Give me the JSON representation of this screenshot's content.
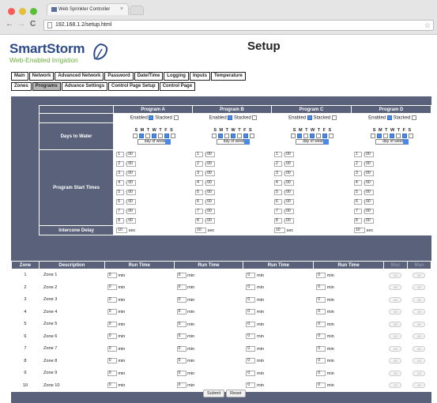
{
  "browser": {
    "tab_title": "Web Sprinkler Controller",
    "tab_close": "×",
    "url": "192.168.1.2/setup.html",
    "back": "←",
    "forward": "→",
    "reload": "C",
    "star": "☆",
    "colors": {
      "close": "#fc5b57",
      "minimize": "#e5bf3c",
      "zoom": "#57c038"
    }
  },
  "brand": {
    "name": "SmartStorm",
    "tagline": "Web-Enabled Irrigation",
    "name_color": "#2d4a8a",
    "tagline_color": "#6aaf3c"
  },
  "page_title": "Setup",
  "nav_row1": [
    {
      "label": "Main",
      "active": false
    },
    {
      "label": "Network",
      "active": false
    },
    {
      "label": "Advanced Network",
      "active": false
    },
    {
      "label": "Password",
      "active": false
    },
    {
      "label": "Date/Time",
      "active": false
    },
    {
      "label": "Logging",
      "active": false
    },
    {
      "label": "Inputs",
      "active": false
    },
    {
      "label": "Temperature",
      "active": false
    }
  ],
  "nav_row2": [
    {
      "label": "Zones",
      "active": false
    },
    {
      "label": "Programs",
      "active": true
    },
    {
      "label": "Advance Settings",
      "active": false
    },
    {
      "label": "Control Page Setup",
      "active": false
    },
    {
      "label": "Control Page",
      "active": false
    }
  ],
  "programs": {
    "enabled_label": "Enabled",
    "stacked_label": "Stacked",
    "days_letters": "S M T W T F S",
    "days_label": "Days to Water",
    "start_times_label": "Program Start Times",
    "interzone_label": "Intercone Delay",
    "sec_unit": "sec",
    "columns": [
      {
        "name": "Program A",
        "enabled": true,
        "stacked": false,
        "day_mode": "day of week",
        "days": [
          false,
          true,
          false,
          true,
          false,
          true,
          false
        ],
        "times": [
          [
            "1",
            "00"
          ],
          [
            "2",
            "00"
          ],
          [
            "3",
            "00"
          ],
          [
            "4",
            "00"
          ],
          [
            "5",
            "00"
          ],
          [
            "6",
            "00"
          ],
          [
            "7",
            "00"
          ],
          [
            "8",
            "00"
          ]
        ],
        "delay": "10"
      },
      {
        "name": "Program B",
        "enabled": true,
        "stacked": false,
        "day_mode": "day of week",
        "days": [
          false,
          true,
          false,
          true,
          false,
          true,
          false
        ],
        "times": [
          [
            "1",
            "00"
          ],
          [
            "2",
            "00"
          ],
          [
            "3",
            "00"
          ],
          [
            "4",
            "00"
          ],
          [
            "5",
            "00"
          ],
          [
            "6",
            "00"
          ],
          [
            "7",
            "00"
          ],
          [
            "8",
            "00"
          ]
        ],
        "delay": "10"
      },
      {
        "name": "Program C",
        "enabled": true,
        "stacked": false,
        "day_mode": "day of week",
        "days": [
          false,
          true,
          false,
          true,
          false,
          true,
          false
        ],
        "times": [
          [
            "1",
            "00"
          ],
          [
            "2",
            "00"
          ],
          [
            "3",
            "00"
          ],
          [
            "4",
            "00"
          ],
          [
            "5",
            "00"
          ],
          [
            "6",
            "00"
          ],
          [
            "7",
            "00"
          ],
          [
            "8",
            "00"
          ]
        ],
        "delay": "10"
      },
      {
        "name": "Program D",
        "enabled": true,
        "stacked": false,
        "day_mode": "day of week",
        "days": [
          false,
          true,
          false,
          true,
          false,
          true,
          false
        ],
        "times": [
          [
            "1",
            "00"
          ],
          [
            "2",
            "00"
          ],
          [
            "3",
            "00"
          ],
          [
            "4",
            "00"
          ],
          [
            "5",
            "00"
          ],
          [
            "6",
            "00"
          ],
          [
            "7",
            "00"
          ],
          [
            "8",
            "00"
          ]
        ],
        "delay": "10"
      }
    ]
  },
  "zones": {
    "headers": {
      "zone": "Zone",
      "description": "Description",
      "run_time": "Run Time",
      "man1": "Man",
      "man2": "Man"
    },
    "unit": "min",
    "button_label": "on",
    "rows": [
      {
        "num": "1",
        "desc": "Zone 1",
        "a": "0",
        "b": "0",
        "c": "0",
        "d": "0"
      },
      {
        "num": "2",
        "desc": "Zone 2",
        "a": "0",
        "b": "0",
        "c": "0",
        "d": "0"
      },
      {
        "num": "3",
        "desc": "Zone 3",
        "a": "0",
        "b": "0",
        "c": "0",
        "d": "0"
      },
      {
        "num": "4",
        "desc": "Zone 4",
        "a": "0",
        "b": "0",
        "c": "0",
        "d": "0"
      },
      {
        "num": "5",
        "desc": "Zone 5",
        "a": "0",
        "b": "0",
        "c": "0",
        "d": "0"
      },
      {
        "num": "6",
        "desc": "Zone 6",
        "a": "0",
        "b": "0",
        "c": "0",
        "d": "0"
      },
      {
        "num": "7",
        "desc": "Zone 7",
        "a": "0",
        "b": "0",
        "c": "0",
        "d": "0"
      },
      {
        "num": "8",
        "desc": "Zone 8",
        "a": "0",
        "b": "0",
        "c": "0",
        "d": "0"
      },
      {
        "num": "9",
        "desc": "Zone 9",
        "a": "0",
        "b": "0",
        "c": "0",
        "d": "0"
      },
      {
        "num": "10",
        "desc": "Zone 10",
        "a": "0",
        "b": "0",
        "c": "0",
        "d": "0"
      }
    ]
  },
  "buttons": {
    "submit": "Submit",
    "reset": "Reset"
  }
}
